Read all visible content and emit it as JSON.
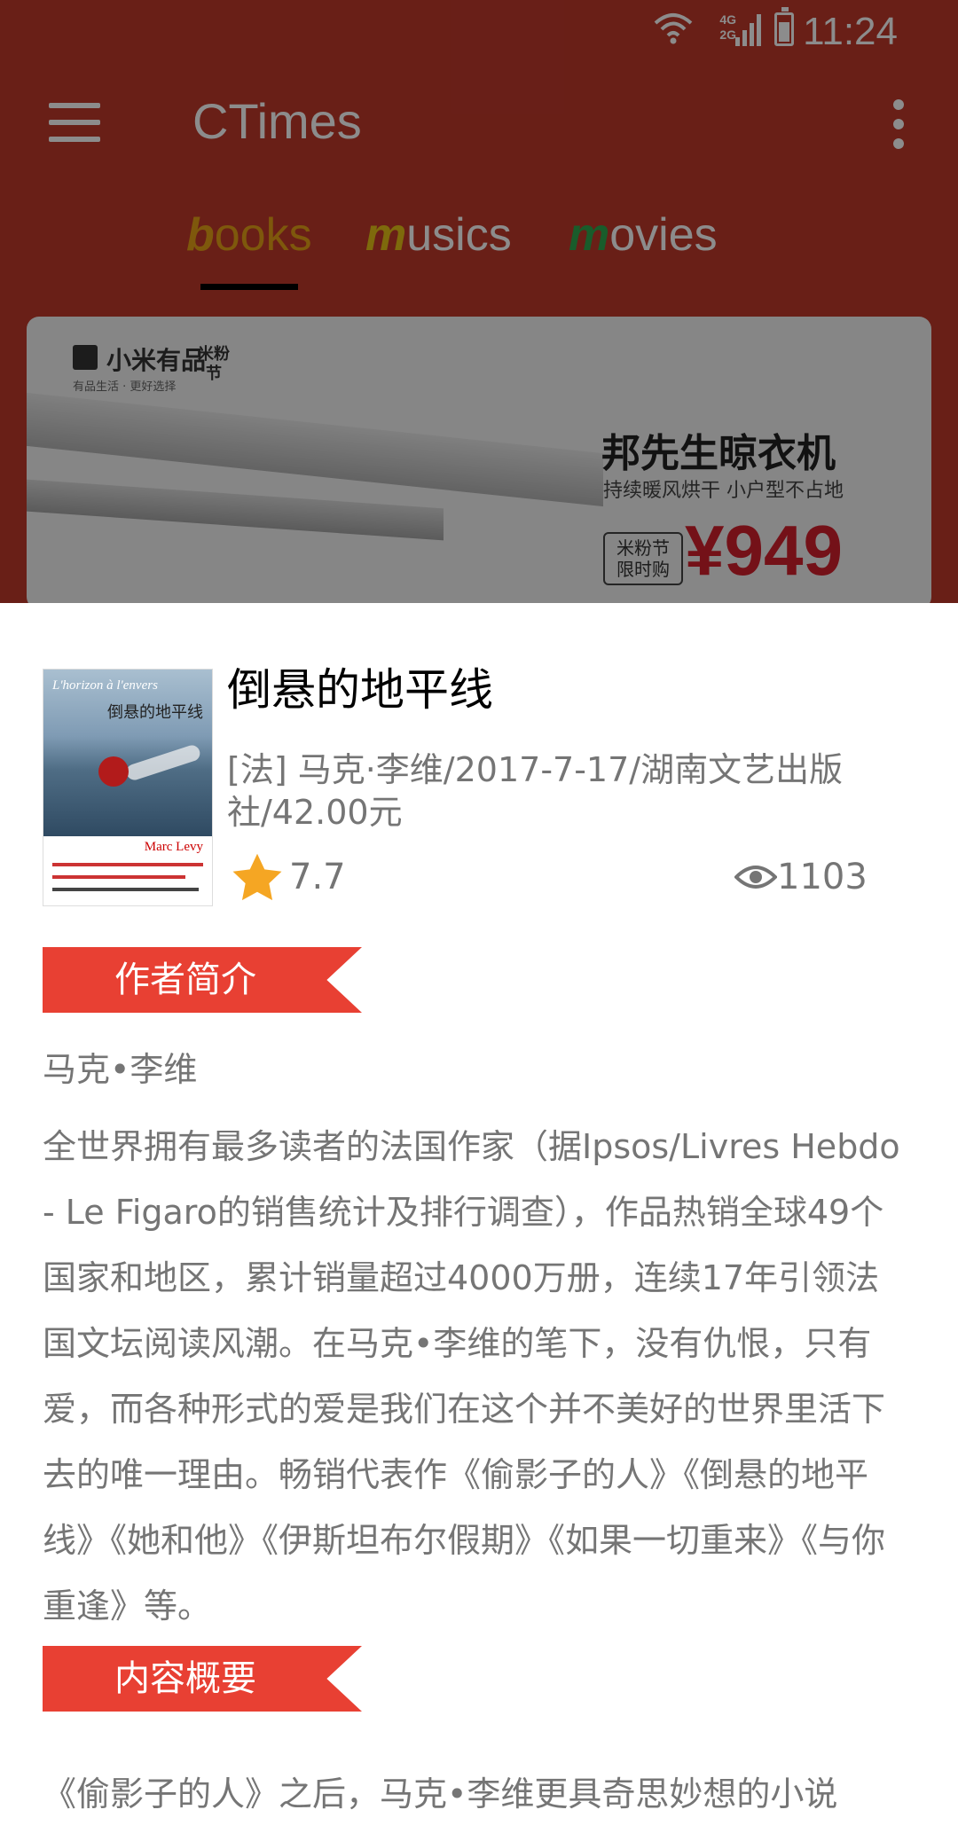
{
  "status_bar": {
    "time": "11:24",
    "network_top": "4G",
    "network_bottom": "2G",
    "wifi_icon": "wifi-icon",
    "battery_icon": "battery-icon"
  },
  "toolbar": {
    "title": "CTimes",
    "menu_icon": "menu-icon",
    "more_icon": "more-vert-icon"
  },
  "tabs": [
    {
      "first": "b",
      "rest": "ooks",
      "first_color": "#e6a117",
      "selected": true
    },
    {
      "first": "m",
      "rest": "usics",
      "first_color": "#e6c117",
      "selected": false
    },
    {
      "first": "m",
      "rest": "ovies",
      "first_color": "#2fa84f",
      "selected": false
    }
  ],
  "banner": {
    "brand": "小米有品",
    "brand_sub": "有品生活 · 更好选择",
    "festival": "米粉节",
    "product_title": "邦先生晾衣机",
    "product_subtitle": "持续暖风烘干 小户型不占地",
    "tag": "米粉节\n限时购",
    "price": "¥949"
  },
  "book": {
    "cover_title_en": "L'horizon à l'envers",
    "cover_title_cn": "倒悬的地平线",
    "cover_author_en": "Marc Levy",
    "title": "倒悬的地平线",
    "meta": "[法] 马克·李维/2017-7-17/湖南文艺出版社/42.00元",
    "rating": "7.7",
    "views": "1103"
  },
  "sections": {
    "author_label": "作者简介",
    "content_label": "内容概要"
  },
  "author": {
    "name": "马克•李维",
    "intro": "全世界拥有最多读者的法国作家（据Ipsos/Livres Hebdo - Le Figaro的销售统计及排行调查），作品热销全球49个国家和地区，累计销量超过4000万册，连续17年引领法国文坛阅读风潮。在马克•李维的笔下，没有仇恨，只有爱，而各种形式的爱是我们在这个并不美好的世界里活下去的唯一理由。畅销代表作《偷影子的人》《倒悬的地平线》《她和他》《伊斯坦布尔假期》《如果一切重来》《与你重逢》等。"
  },
  "content": {
    "summary": "《偷影子的人》之后，马克•李维更具奇思妙想的小说"
  },
  "colors": {
    "app_bar": "#c0392b",
    "section_tag": "#e84033",
    "text_secondary": "#757575",
    "star": "#f5a623"
  }
}
